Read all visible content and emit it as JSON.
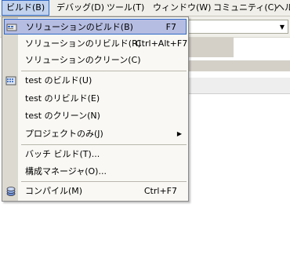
{
  "menubar": {
    "items": [
      {
        "label": "ビルド(B)"
      },
      {
        "label": "デバッグ(D)"
      },
      {
        "label": "ツール(T)"
      },
      {
        "label": "ウィンドウ(W)"
      },
      {
        "label": "コミュニティ(C)"
      },
      {
        "label": "ヘル"
      }
    ]
  },
  "build_menu": {
    "items": [
      {
        "label": "ソリューションのビルド(B)",
        "shortcut": "F7",
        "icon": "build-solution-icon"
      },
      {
        "label": "ソリューションのリビルド(R)",
        "shortcut": "Ctrl+Alt+F7"
      },
      {
        "label": "ソリューションのクリーン(C)"
      },
      {
        "label": "test のビルド(U)",
        "icon": "build-project-icon"
      },
      {
        "label": "test のリビルド(E)"
      },
      {
        "label": "test のクリーン(N)"
      },
      {
        "label": "プロジェクトのみ(J)",
        "submenu_icon": "submenu-arrow-icon"
      },
      {
        "label": "バッチ ビルド(T)..."
      },
      {
        "label": "構成マネージャ(O)..."
      },
      {
        "label": "コンパイル(M)",
        "shortcut": "Ctrl+F7",
        "icon": "compile-icon"
      }
    ]
  },
  "colors": {
    "menubar_bg": "#f0efe9",
    "highlight_bg": "#b6bde2",
    "highlight_border": "#316ac5",
    "menu_bg": "#f9f8f4",
    "gutter_bg": "#dcdad0"
  }
}
